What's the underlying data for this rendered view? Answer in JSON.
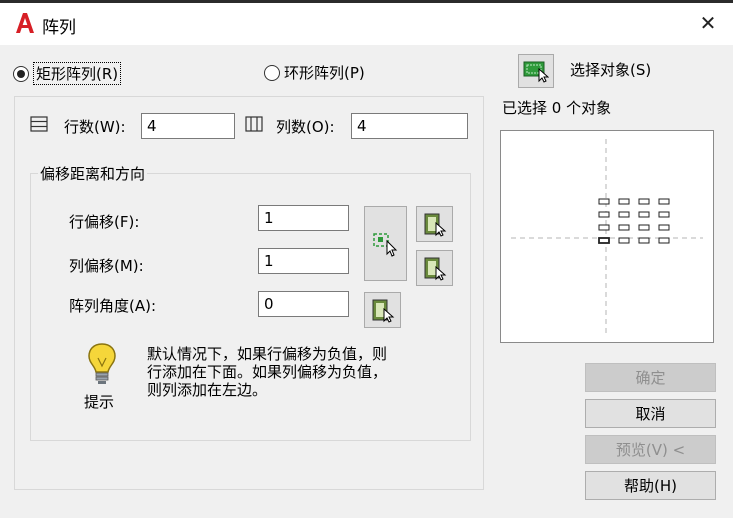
{
  "window": {
    "title": "阵列",
    "close_glyph": "✕"
  },
  "array_type": {
    "rectangular_label": "矩形阵列(R)",
    "rectangular_selected": true,
    "polar_label": "环形阵列(P)",
    "polar_selected": false
  },
  "selection": {
    "select_objects_label": "选择对象(S)",
    "selected_status": "已选择 0 个对象"
  },
  "grid": {
    "rows_label": "行数(W):",
    "rows_value": "4",
    "columns_label": "列数(O):",
    "columns_value": "4"
  },
  "offset": {
    "group_title": "偏移距离和方向",
    "row_offset_label": "行偏移(F):",
    "row_offset_value": "1",
    "column_offset_label": "列偏移(M):",
    "column_offset_value": "1",
    "angle_label": "阵列角度(A):",
    "angle_value": "0"
  },
  "tip": {
    "caption": "提示",
    "line1": "默认情况下，如果行偏移为负值，则",
    "line2": "行添加在下面。如果列偏移为负值，",
    "line3": "则列添加在左边。"
  },
  "buttons": {
    "ok": "确定",
    "ok_enabled": false,
    "cancel": "取消",
    "cancel_enabled": true,
    "preview": "预览(V) <",
    "preview_enabled": false,
    "help": "帮助(H)",
    "help_enabled": true
  },
  "colors": {
    "brand_red": "#d71f26",
    "icon_green": "#2e9a3a",
    "disabled_text": "#8f8f8f"
  },
  "icons": {
    "app": "autocad-logo-icon",
    "close": "close-icon",
    "select_objects": "select-objects-icon",
    "rows": "rows-icon",
    "columns": "columns-icon",
    "pick_both_offsets": "pick-both-offsets-icon",
    "pick_row_offset": "pick-row-offset-icon",
    "pick_column_offset": "pick-column-offset-icon",
    "pick_angle": "pick-angle-icon",
    "tip": "lightbulb-icon"
  }
}
